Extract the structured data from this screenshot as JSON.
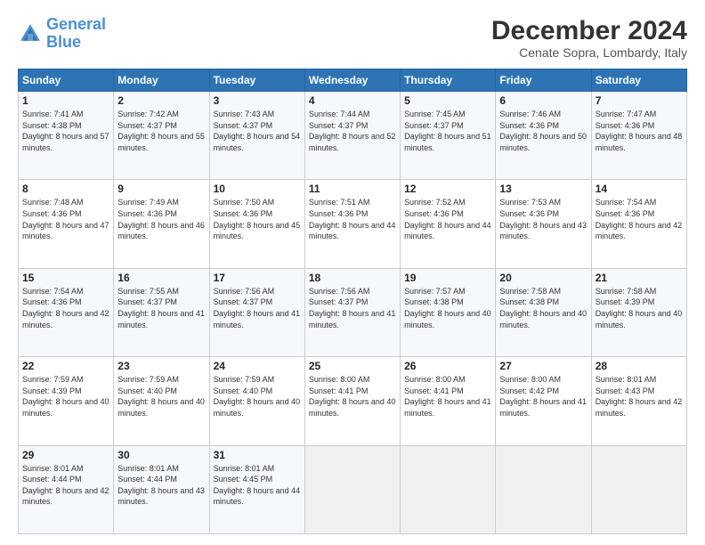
{
  "logo": {
    "line1": "General",
    "line2": "Blue"
  },
  "title": "December 2024",
  "subtitle": "Cenate Sopra, Lombardy, Italy",
  "weekdays": [
    "Sunday",
    "Monday",
    "Tuesday",
    "Wednesday",
    "Thursday",
    "Friday",
    "Saturday"
  ],
  "weeks": [
    [
      {
        "day": "1",
        "sunrise": "Sunrise: 7:41 AM",
        "sunset": "Sunset: 4:38 PM",
        "daylight": "Daylight: 8 hours and 57 minutes."
      },
      {
        "day": "2",
        "sunrise": "Sunrise: 7:42 AM",
        "sunset": "Sunset: 4:37 PM",
        "daylight": "Daylight: 8 hours and 55 minutes."
      },
      {
        "day": "3",
        "sunrise": "Sunrise: 7:43 AM",
        "sunset": "Sunset: 4:37 PM",
        "daylight": "Daylight: 8 hours and 54 minutes."
      },
      {
        "day": "4",
        "sunrise": "Sunrise: 7:44 AM",
        "sunset": "Sunset: 4:37 PM",
        "daylight": "Daylight: 8 hours and 52 minutes."
      },
      {
        "day": "5",
        "sunrise": "Sunrise: 7:45 AM",
        "sunset": "Sunset: 4:37 PM",
        "daylight": "Daylight: 8 hours and 51 minutes."
      },
      {
        "day": "6",
        "sunrise": "Sunrise: 7:46 AM",
        "sunset": "Sunset: 4:36 PM",
        "daylight": "Daylight: 8 hours and 50 minutes."
      },
      {
        "day": "7",
        "sunrise": "Sunrise: 7:47 AM",
        "sunset": "Sunset: 4:36 PM",
        "daylight": "Daylight: 8 hours and 48 minutes."
      }
    ],
    [
      {
        "day": "8",
        "sunrise": "Sunrise: 7:48 AM",
        "sunset": "Sunset: 4:36 PM",
        "daylight": "Daylight: 8 hours and 47 minutes."
      },
      {
        "day": "9",
        "sunrise": "Sunrise: 7:49 AM",
        "sunset": "Sunset: 4:36 PM",
        "daylight": "Daylight: 8 hours and 46 minutes."
      },
      {
        "day": "10",
        "sunrise": "Sunrise: 7:50 AM",
        "sunset": "Sunset: 4:36 PM",
        "daylight": "Daylight: 8 hours and 45 minutes."
      },
      {
        "day": "11",
        "sunrise": "Sunrise: 7:51 AM",
        "sunset": "Sunset: 4:36 PM",
        "daylight": "Daylight: 8 hours and 44 minutes."
      },
      {
        "day": "12",
        "sunrise": "Sunrise: 7:52 AM",
        "sunset": "Sunset: 4:36 PM",
        "daylight": "Daylight: 8 hours and 44 minutes."
      },
      {
        "day": "13",
        "sunrise": "Sunrise: 7:53 AM",
        "sunset": "Sunset: 4:36 PM",
        "daylight": "Daylight: 8 hours and 43 minutes."
      },
      {
        "day": "14",
        "sunrise": "Sunrise: 7:54 AM",
        "sunset": "Sunset: 4:36 PM",
        "daylight": "Daylight: 8 hours and 42 minutes."
      }
    ],
    [
      {
        "day": "15",
        "sunrise": "Sunrise: 7:54 AM",
        "sunset": "Sunset: 4:36 PM",
        "daylight": "Daylight: 8 hours and 42 minutes."
      },
      {
        "day": "16",
        "sunrise": "Sunrise: 7:55 AM",
        "sunset": "Sunset: 4:37 PM",
        "daylight": "Daylight: 8 hours and 41 minutes."
      },
      {
        "day": "17",
        "sunrise": "Sunrise: 7:56 AM",
        "sunset": "Sunset: 4:37 PM",
        "daylight": "Daylight: 8 hours and 41 minutes."
      },
      {
        "day": "18",
        "sunrise": "Sunrise: 7:56 AM",
        "sunset": "Sunset: 4:37 PM",
        "daylight": "Daylight: 8 hours and 41 minutes."
      },
      {
        "day": "19",
        "sunrise": "Sunrise: 7:57 AM",
        "sunset": "Sunset: 4:38 PM",
        "daylight": "Daylight: 8 hours and 40 minutes."
      },
      {
        "day": "20",
        "sunrise": "Sunrise: 7:58 AM",
        "sunset": "Sunset: 4:38 PM",
        "daylight": "Daylight: 8 hours and 40 minutes."
      },
      {
        "day": "21",
        "sunrise": "Sunrise: 7:58 AM",
        "sunset": "Sunset: 4:39 PM",
        "daylight": "Daylight: 8 hours and 40 minutes."
      }
    ],
    [
      {
        "day": "22",
        "sunrise": "Sunrise: 7:59 AM",
        "sunset": "Sunset: 4:39 PM",
        "daylight": "Daylight: 8 hours and 40 minutes."
      },
      {
        "day": "23",
        "sunrise": "Sunrise: 7:59 AM",
        "sunset": "Sunset: 4:40 PM",
        "daylight": "Daylight: 8 hours and 40 minutes."
      },
      {
        "day": "24",
        "sunrise": "Sunrise: 7:59 AM",
        "sunset": "Sunset: 4:40 PM",
        "daylight": "Daylight: 8 hours and 40 minutes."
      },
      {
        "day": "25",
        "sunrise": "Sunrise: 8:00 AM",
        "sunset": "Sunset: 4:41 PM",
        "daylight": "Daylight: 8 hours and 40 minutes."
      },
      {
        "day": "26",
        "sunrise": "Sunrise: 8:00 AM",
        "sunset": "Sunset: 4:41 PM",
        "daylight": "Daylight: 8 hours and 41 minutes."
      },
      {
        "day": "27",
        "sunrise": "Sunrise: 8:00 AM",
        "sunset": "Sunset: 4:42 PM",
        "daylight": "Daylight: 8 hours and 41 minutes."
      },
      {
        "day": "28",
        "sunrise": "Sunrise: 8:01 AM",
        "sunset": "Sunset: 4:43 PM",
        "daylight": "Daylight: 8 hours and 42 minutes."
      }
    ],
    [
      {
        "day": "29",
        "sunrise": "Sunrise: 8:01 AM",
        "sunset": "Sunset: 4:44 PM",
        "daylight": "Daylight: 8 hours and 42 minutes."
      },
      {
        "day": "30",
        "sunrise": "Sunrise: 8:01 AM",
        "sunset": "Sunset: 4:44 PM",
        "daylight": "Daylight: 8 hours and 43 minutes."
      },
      {
        "day": "31",
        "sunrise": "Sunrise: 8:01 AM",
        "sunset": "Sunset: 4:45 PM",
        "daylight": "Daylight: 8 hours and 44 minutes."
      },
      null,
      null,
      null,
      null
    ]
  ]
}
